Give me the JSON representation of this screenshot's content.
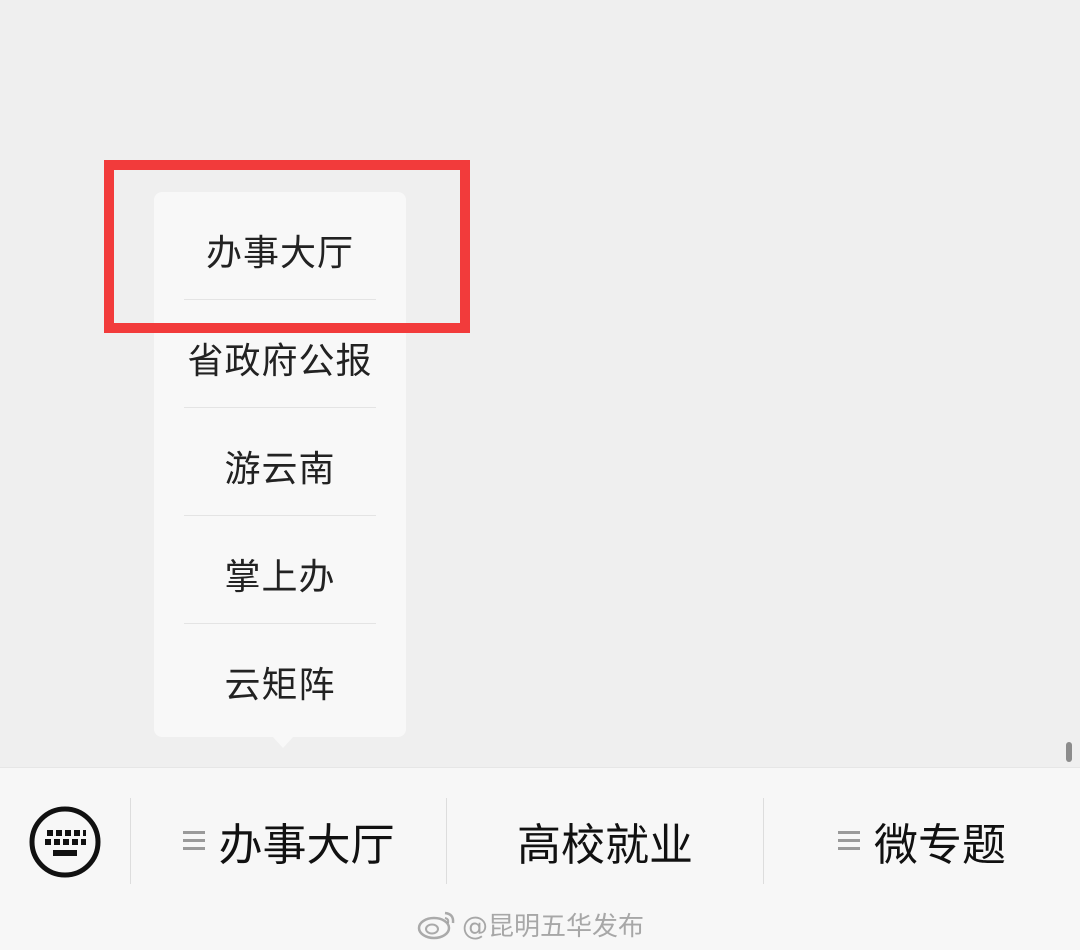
{
  "popup_menu": {
    "items": [
      {
        "label": "办事大厅"
      },
      {
        "label": "省政府公报"
      },
      {
        "label": "游云南"
      },
      {
        "label": "掌上办"
      },
      {
        "label": "云矩阵"
      }
    ]
  },
  "bottom_bar": {
    "keyboard_icon": "keyboard-icon",
    "tabs": [
      {
        "label": "办事大厅",
        "has_menu_icon": true
      },
      {
        "label": "高校就业",
        "has_menu_icon": false
      },
      {
        "label": "微专题",
        "has_menu_icon": true
      }
    ]
  },
  "watermark": {
    "text": "@昆明五华发布",
    "icon": "weibo-icon"
  },
  "colors": {
    "highlight": "#f23b3b",
    "background": "#efefef",
    "menu_background": "#f8f8f8"
  }
}
